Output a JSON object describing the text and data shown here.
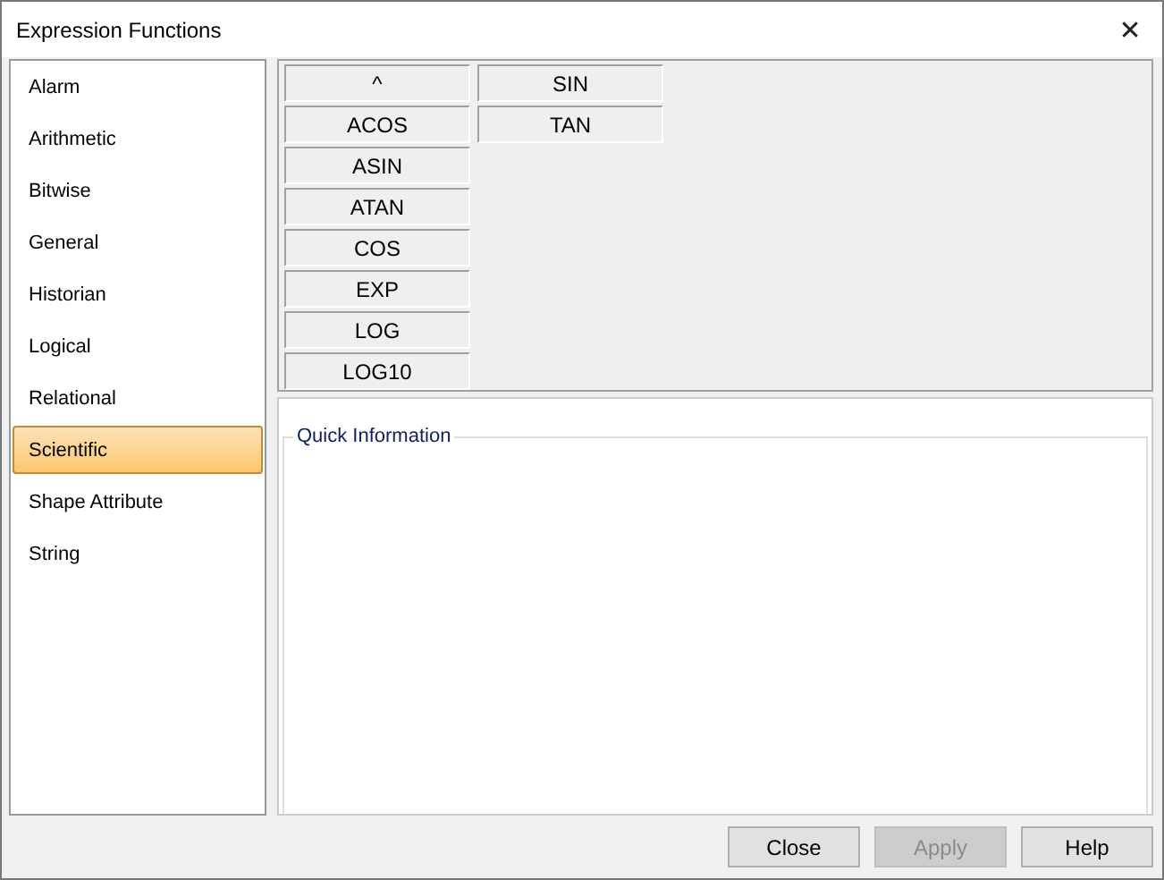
{
  "window": {
    "title": "Expression Functions",
    "close": "✕"
  },
  "categories": [
    {
      "label": "Alarm",
      "selected": false
    },
    {
      "label": "Arithmetic",
      "selected": false
    },
    {
      "label": "Bitwise",
      "selected": false
    },
    {
      "label": "General",
      "selected": false
    },
    {
      "label": "Historian",
      "selected": false
    },
    {
      "label": "Logical",
      "selected": false
    },
    {
      "label": "Relational",
      "selected": false
    },
    {
      "label": "Scientific",
      "selected": true
    },
    {
      "label": "Shape Attribute",
      "selected": false
    },
    {
      "label": "String",
      "selected": false
    }
  ],
  "functions": [
    "^",
    "ACOS",
    "ASIN",
    "ATAN",
    "COS",
    "EXP",
    "LOG",
    "LOG10",
    "SIN",
    "TAN"
  ],
  "quick_information": {
    "title": "Quick Information"
  },
  "buttons": [
    {
      "label": "Close",
      "disabled": false
    },
    {
      "label": "Apply",
      "disabled": true
    },
    {
      "label": "Help",
      "disabled": false
    }
  ]
}
